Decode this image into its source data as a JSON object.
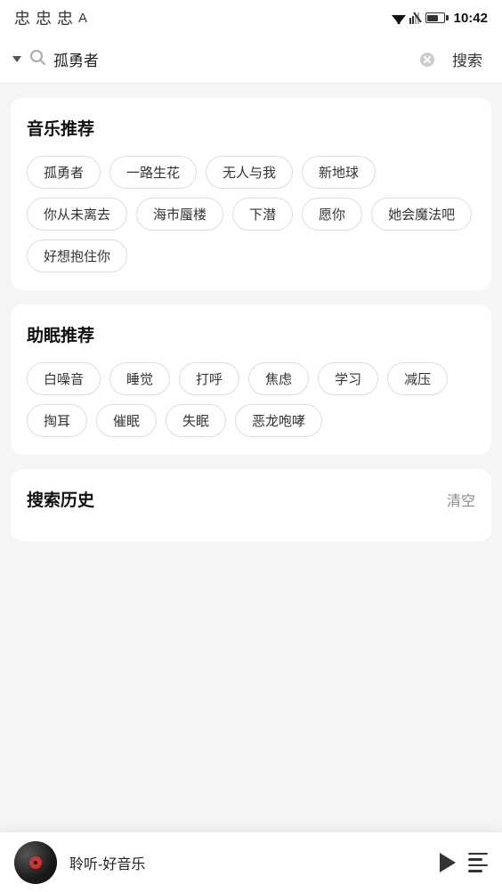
{
  "statusBar": {
    "time": "10:42",
    "icons": [
      "忠",
      "忠",
      "忠",
      "A"
    ]
  },
  "searchBar": {
    "query": "孤勇者",
    "placeholder": "搜索",
    "submitLabel": "搜索",
    "clearIcon": "×"
  },
  "musicSection": {
    "title": "音乐推荐",
    "tags": [
      "孤勇者",
      "一路生花",
      "无人与我",
      "新地球",
      "你从未离去",
      "海市蜃楼",
      "下潜",
      "愿你",
      "她会魔法吧",
      "好想抱住你"
    ]
  },
  "sleepSection": {
    "title": "助眠推荐",
    "tags": [
      "白噪音",
      "睡觉",
      "打呼",
      "焦虑",
      "学习",
      "减压",
      "掏耳",
      "催眠",
      "失眠",
      "恶龙咆哮"
    ]
  },
  "historySection": {
    "title": "搜索历史",
    "clearLabel": "清空",
    "items": []
  },
  "player": {
    "title": "聆听-好音乐",
    "playIcon": "play",
    "playlistIcon": "playlist"
  }
}
